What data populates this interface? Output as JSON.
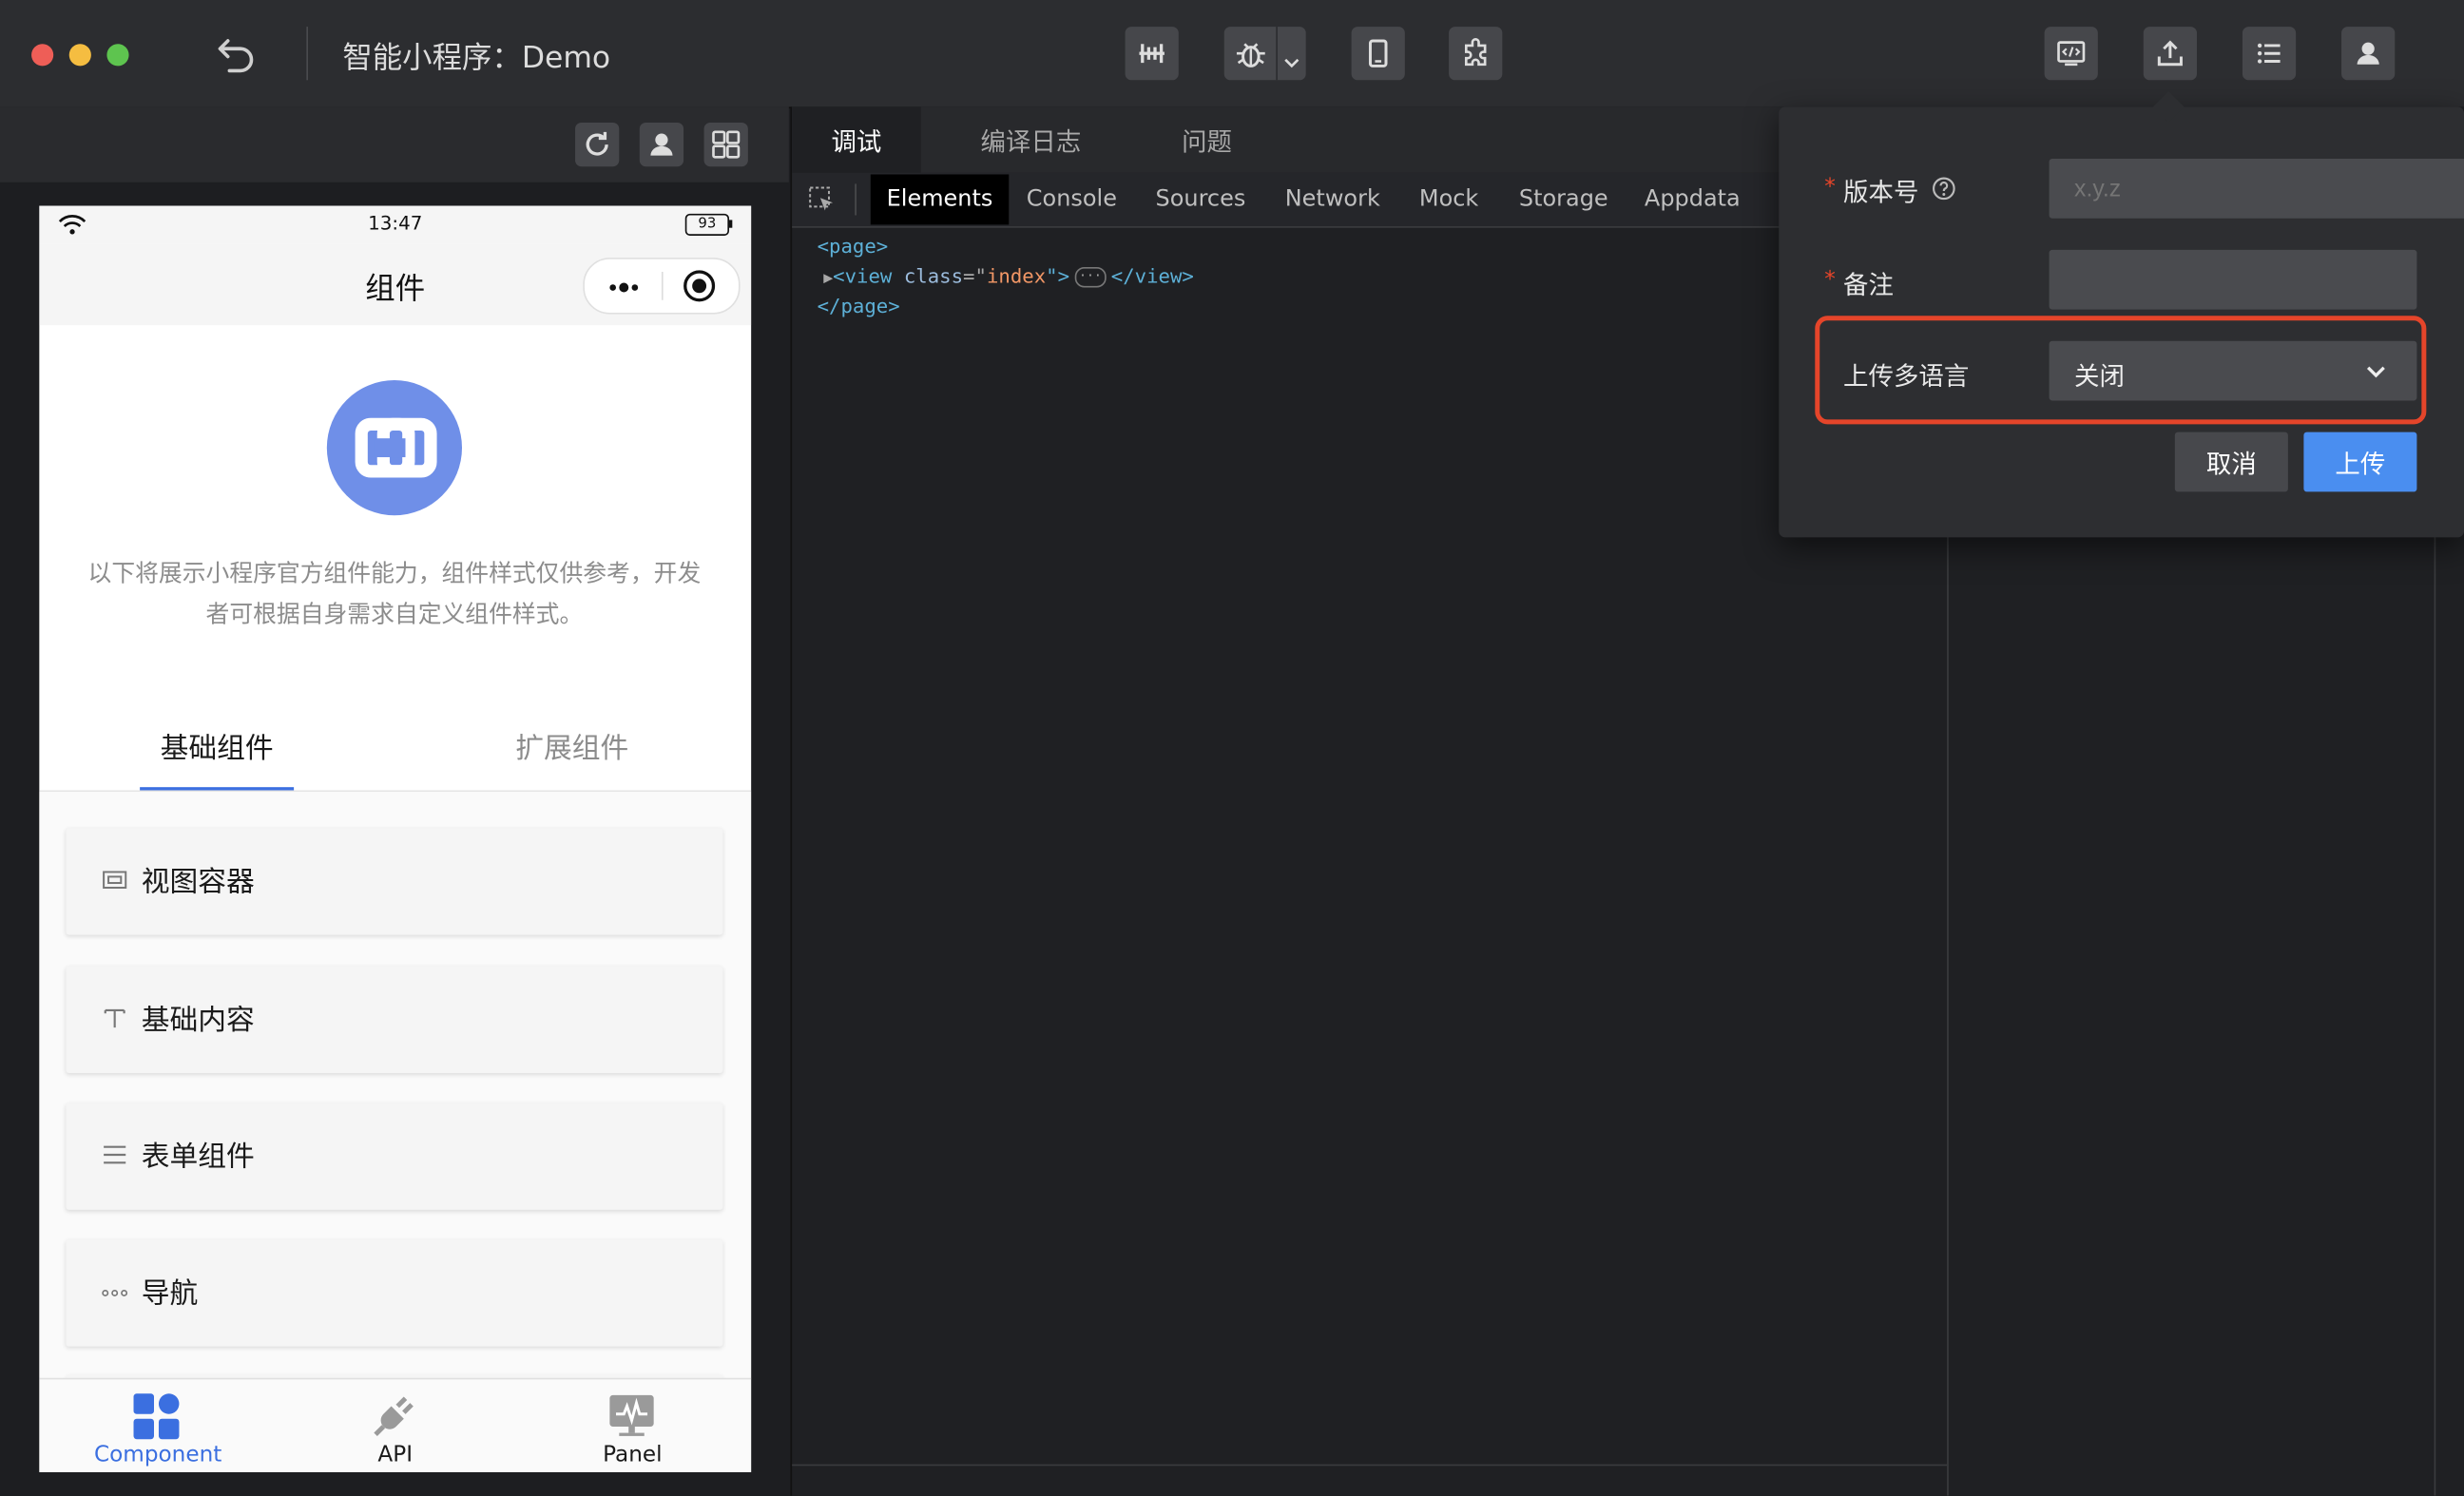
{
  "titlebar": {
    "back_icon": "undo-icon",
    "title": "智能小程序：Demo",
    "center_tools": [
      "compile-icon",
      "debug-icon",
      "device-icon",
      "plugin-icon"
    ],
    "right_tools": [
      "code-icon",
      "upload-icon",
      "list-icon",
      "user-icon"
    ]
  },
  "simulator": {
    "toolbar_icons": [
      "refresh-icon",
      "user-icon",
      "grid-icon"
    ],
    "status": {
      "time": "13:47",
      "battery": "93"
    },
    "nav_title": "组件",
    "intro": "以下将展示小程序官方组件能力，组件样式仅供参考，开发者可根据自身需求自定义组件样式。",
    "tabs": [
      {
        "label": "基础组件",
        "active": true
      },
      {
        "label": "扩展组件",
        "active": false
      }
    ],
    "items": [
      {
        "label": "视图容器",
        "icon": "view-container-icon"
      },
      {
        "label": "基础内容",
        "icon": "text-icon"
      },
      {
        "label": "表单组件",
        "icon": "form-lines-icon"
      },
      {
        "label": "导航",
        "icon": "dots-icon"
      }
    ],
    "bottom_tabs": [
      {
        "label": "Component",
        "active": true
      },
      {
        "label": "API",
        "active": false
      },
      {
        "label": "Panel",
        "active": false
      }
    ]
  },
  "devtools": {
    "main_tabs": [
      {
        "label": "调试",
        "active": true
      },
      {
        "label": "编译日志"
      },
      {
        "label": "问题"
      }
    ],
    "sub_tabs": [
      {
        "label": "Elements",
        "active": true
      },
      {
        "label": "Console"
      },
      {
        "label": "Sources"
      },
      {
        "label": "Network"
      },
      {
        "label": "Mock"
      },
      {
        "label": "Storage"
      },
      {
        "label": "Appdata"
      }
    ],
    "dom": {
      "line1": "<page>",
      "tag_open": "<view ",
      "attr_name": "class",
      "attr_eq": "=\"",
      "attr_value": "index",
      "attr_close": "\">",
      "ellipsis": "···",
      "tag_close": "</view>",
      "line3": "</page>"
    }
  },
  "upload_dialog": {
    "version": {
      "required_mark": "*",
      "label": "版本号",
      "placeholder": "x.y.z",
      "value": ""
    },
    "note": {
      "required_mark": "*",
      "label": "备注",
      "value": ""
    },
    "multilang": {
      "label": "上传多语言",
      "selected": "关闭"
    },
    "cancel_label": "取消",
    "upload_label": "上传",
    "highlight_color": "#e5452a",
    "primary_color": "#4a8ef0"
  }
}
